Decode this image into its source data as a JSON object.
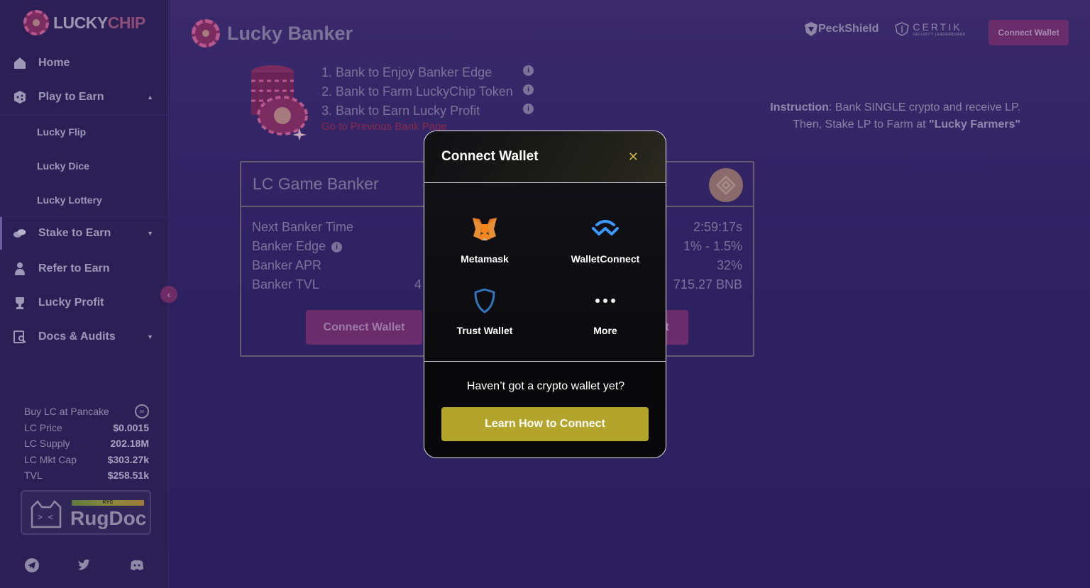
{
  "brand": {
    "name_a": "LUCKY",
    "name_b": "CHIP"
  },
  "sidebar": {
    "items": [
      {
        "label": "Home",
        "icon": "home-icon"
      },
      {
        "label": "Play to Earn",
        "icon": "dice-icon"
      },
      {
        "label": "Stake to Earn",
        "icon": "coins-icon"
      },
      {
        "label": "Refer to Earn",
        "icon": "user-icon"
      },
      {
        "label": "Lucky Profit",
        "icon": "trophy-icon"
      },
      {
        "label": "Docs & Audits",
        "icon": "document-search-icon"
      }
    ],
    "sub_items": [
      "Lucky Flip",
      "Lucky Dice",
      "Lucky Lottery"
    ],
    "stats": {
      "buy_label": "Buy LC at Pancake",
      "rows": [
        {
          "label": "LC Price",
          "value": "$0.0015"
        },
        {
          "label": "LC Supply",
          "value": "202.18M"
        },
        {
          "label": "LC Mkt Cap",
          "value": "$303.27k"
        },
        {
          "label": "TVL",
          "value": "$258.51k"
        }
      ]
    },
    "rugdoc": {
      "badge": "KYC",
      "name": "RugDoc"
    }
  },
  "header": {
    "title": "Lucky Banker",
    "peckshield": "PeckShield",
    "certik": "CERTIK",
    "certik_sub": "SECURITY LEADERBOARD",
    "connect_label": "Connect Wallet"
  },
  "steps": [
    "1. Bank to Enjoy Banker Edge",
    "2. Bank to Farm LuckyChip Token",
    "3. Bank to Earn Lucky Profit"
  ],
  "prev_link": "Go to Previous Bank Page",
  "instruction": {
    "bold1": "Instruction",
    "line1": ": Bank SINGLE crypto and receive LP.",
    "line2": "Then, Stake LP to Farm at ",
    "bold2": "\"Lucky Farmers\""
  },
  "card": {
    "title": "LC Game Banker",
    "rows": [
      {
        "label": "Next Banker Time",
        "value": "2:59:17s"
      },
      {
        "label": "Banker Edge",
        "value": "1% - 1.5%"
      },
      {
        "label": "Banker APR",
        "value": "32%"
      },
      {
        "label": "Banker TVL",
        "mid": "4",
        "value": "715.27 BNB"
      }
    ],
    "btn_left": "Connect Wallet",
    "btn_right": "t"
  },
  "modal": {
    "title": "Connect Wallet",
    "close": "✕",
    "wallets": [
      {
        "label": "Metamask",
        "icon": "metamask-fox-icon"
      },
      {
        "label": "WalletConnect",
        "icon": "walletconnect-icon"
      },
      {
        "label": "Trust Wallet",
        "icon": "trust-wallet-shield-icon"
      },
      {
        "label": "More",
        "icon": "more-dots-icon"
      }
    ],
    "foot_text": "Haven’t got a crypto wallet yet?",
    "learn_label": "Learn How to Connect"
  },
  "colors": {
    "sidebar_bg": "#2b1f56",
    "main_bg": "#2f2263",
    "modal_bg": "#0e0d12",
    "learn_button": "#b3a52b",
    "close_icon": "#c8b24a",
    "walletconnect_blue": "#3b99fc"
  }
}
